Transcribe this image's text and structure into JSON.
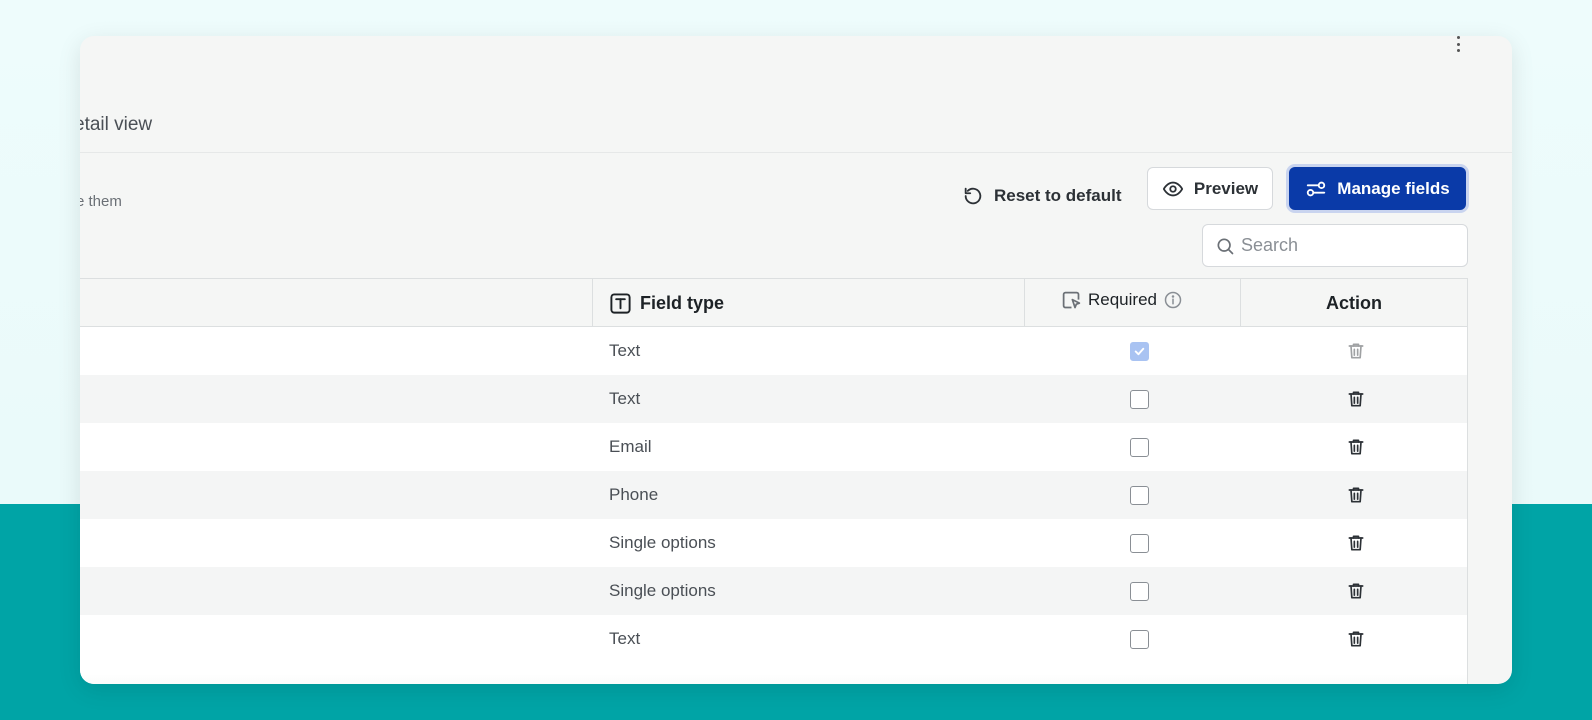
{
  "header": {
    "breadcrumb_partial": "etail view",
    "hint_partial": "e them"
  },
  "toolbar": {
    "reset_label": "Reset to default",
    "preview_label": "Preview",
    "manage_label": "Manage fields"
  },
  "search": {
    "placeholder": "Search",
    "value": ""
  },
  "table": {
    "columns": {
      "field_type": "Field type",
      "required": "Required",
      "action": "Action"
    },
    "rows": [
      {
        "field_type": "Text",
        "required": true,
        "locked": true
      },
      {
        "field_type": "Text",
        "required": false,
        "locked": false
      },
      {
        "field_type": "Email",
        "required": false,
        "locked": false
      },
      {
        "field_type": "Phone",
        "required": false,
        "locked": false
      },
      {
        "field_type": "Single options",
        "required": false,
        "locked": false
      },
      {
        "field_type": "Single options",
        "required": false,
        "locked": false
      },
      {
        "field_type": "Text",
        "required": false,
        "locked": false
      }
    ]
  },
  "colors": {
    "accent": "#0a3aa8",
    "teal_band": "#00a4a6",
    "checked_disabled": "#a9c3f2"
  }
}
